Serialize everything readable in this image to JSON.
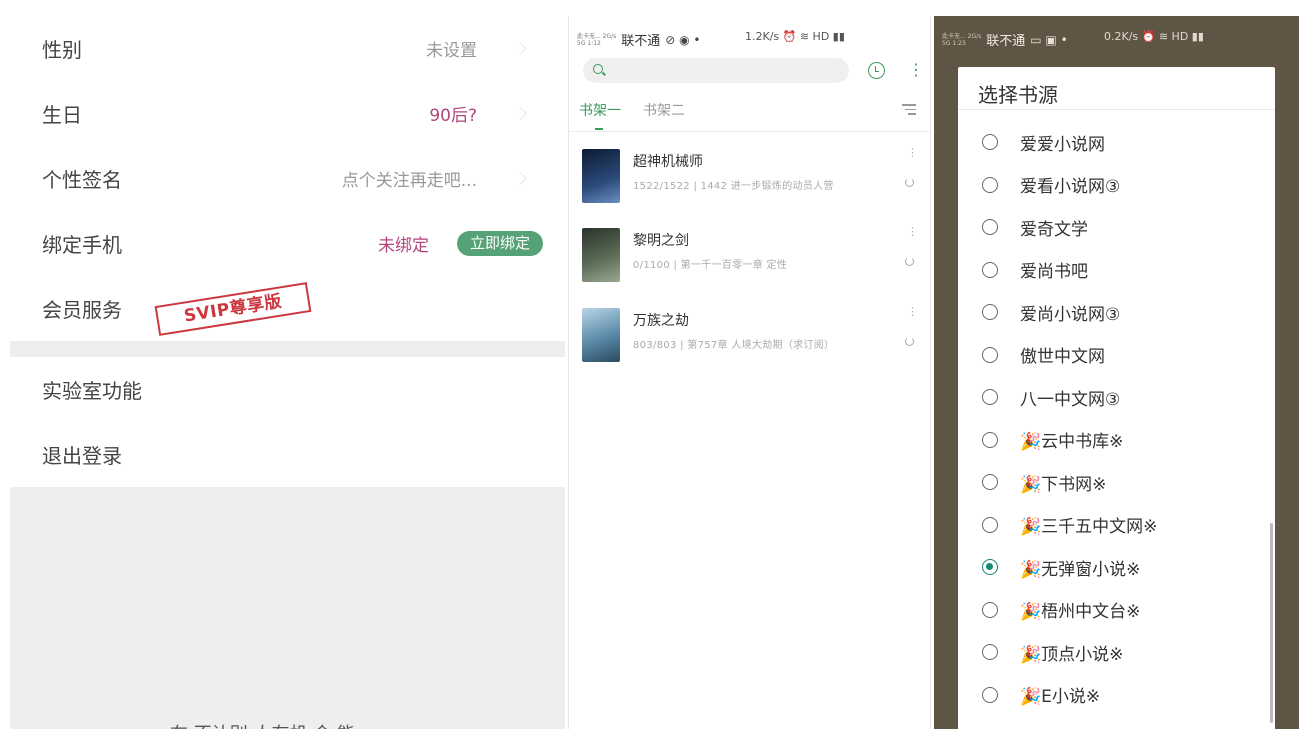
{
  "profile": {
    "rows": [
      {
        "label": "性别",
        "value": "未设置"
      },
      {
        "label": "生日",
        "value": "90后?"
      },
      {
        "label": "个性签名",
        "value": "点个关注再走吧..."
      },
      {
        "label": "绑定手机",
        "value": "未绑定",
        "button": "立即绑定"
      },
      {
        "label": "会员服务",
        "badge": "SVIP尊享版"
      }
    ],
    "rows2": [
      {
        "label": "实验室功能"
      },
      {
        "label": "退出登录"
      }
    ],
    "bottom_text": "在 不让别 人有机 会 能"
  },
  "status_bar": {
    "tiny_top": "此卡无... 2G/s",
    "tiny_bottom": "5G 1:12",
    "carrier_name": "联不通",
    "right_text": "1.2K/s ⏰ ≋ HD ▮▮",
    "p3_tiny_bottom": "5G 1:23",
    "p3_right_text": "0.2K/s ⏰ ≋ HD ▮▮"
  },
  "bookshelf": {
    "tabs": [
      "书架一",
      "书架二"
    ],
    "accent": "#3a9a5b",
    "books": [
      {
        "title": "超神机械师",
        "meta": "1522/1522 | 1442 进一步锻炼的动员人营",
        "cover_color": "#1b2a4a"
      },
      {
        "title": "黎明之剑",
        "meta": "0/1100 | 第一千一百零一章 定性",
        "cover_color": "#3b4a3a"
      },
      {
        "title": "万族之劫",
        "meta": "803/803 | 第757章 人境大劫期（求订阅）",
        "cover_color": "#5a8aa8"
      }
    ]
  },
  "source_dialog": {
    "title": "选择书源",
    "options": [
      {
        "name": "爱爱小说网",
        "selected": false
      },
      {
        "name": "爱看小说网③",
        "selected": false
      },
      {
        "name": "爱奇文学",
        "selected": false
      },
      {
        "name": "爱尚书吧",
        "selected": false
      },
      {
        "name": "爱尚小说网③",
        "selected": false
      },
      {
        "name": "傲世中文网",
        "selected": false
      },
      {
        "name": "八一中文网③",
        "selected": false
      },
      {
        "name": "🎉云中书库※",
        "selected": false
      },
      {
        "name": "🎉下书网※",
        "selected": false
      },
      {
        "name": "🎉三千五中文网※",
        "selected": false
      },
      {
        "name": "🎉无弹窗小说※",
        "selected": true
      },
      {
        "name": "🎉梧州中文台※",
        "selected": false
      },
      {
        "name": "🎉顶点小说※",
        "selected": false
      },
      {
        "name": "🎉E小说※",
        "selected": false
      }
    ],
    "accent": "#138a72"
  }
}
